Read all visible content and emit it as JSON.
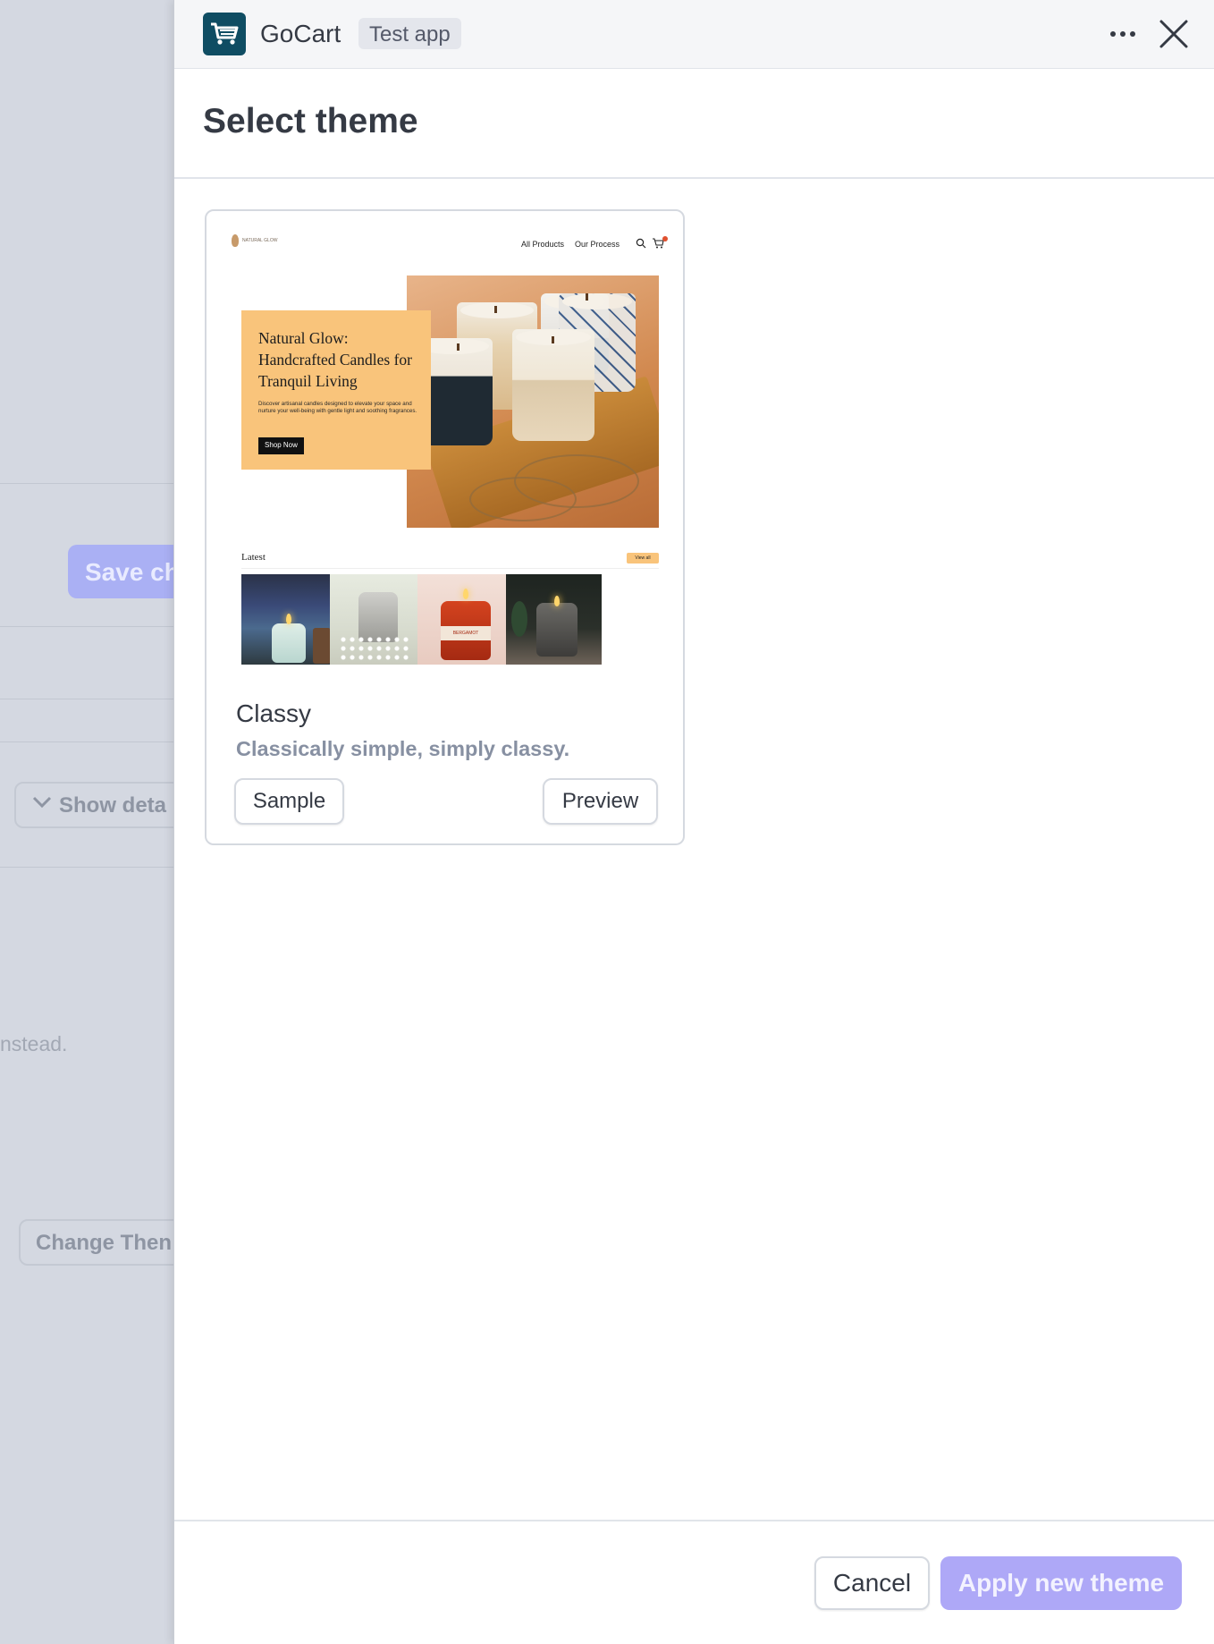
{
  "background": {
    "save_button_label": "Save ch",
    "show_details_label": "Show deta",
    "instead_text": "nstead.",
    "change_theme_label": "Change Then"
  },
  "header": {
    "app_name": "GoCart",
    "badge": "Test app",
    "more_icon": "more-horizontal-icon",
    "close_icon": "close-icon"
  },
  "page": {
    "title": "Select theme"
  },
  "theme": {
    "preview": {
      "logo_text": "NATURAL GLOW",
      "nav": [
        "All Products",
        "Our Process"
      ],
      "hero_title": "Natural Glow: Handcrafted Candles for Tranquil Living",
      "hero_desc": "Discover artisanal candles designed to elevate your space and nurture your well-being with gentle light and soothing fragrances.",
      "hero_button": "Shop Now",
      "latest_label": "Latest",
      "view_all": "View all",
      "product_label": "BERGAMOT"
    },
    "name": "Classy",
    "description": "Classically simple, simply classy.",
    "sample_label": "Sample",
    "preview_label": "Preview"
  },
  "footer": {
    "cancel_label": "Cancel",
    "apply_label": "Apply new theme"
  },
  "colors": {
    "app_icon_bg": "#0f4d63",
    "apply_button_bg": "#aea8f7",
    "hero_card_bg": "#f9c47b"
  }
}
